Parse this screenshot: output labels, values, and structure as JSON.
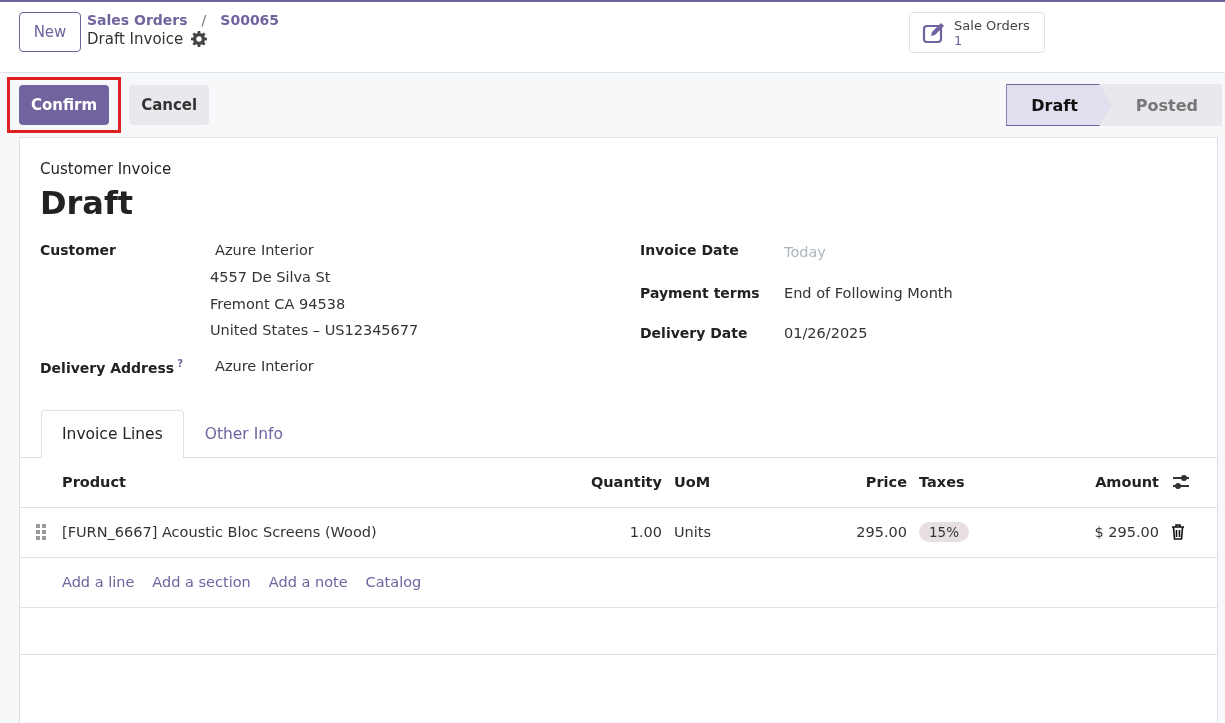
{
  "control_panel": {
    "new_button": "New",
    "breadcrumb_separator": "/",
    "breadcrumb": [
      {
        "label": "Sales Orders"
      },
      {
        "label": "S00065"
      }
    ],
    "record_title": "Draft Invoice",
    "smart_button": {
      "label": "Sale Orders",
      "count": "1"
    }
  },
  "actions": [
    {
      "label": "Confirm",
      "kind": "primary",
      "highlighted": true
    },
    {
      "label": "Cancel",
      "kind": "secondary",
      "highlighted": false
    }
  ],
  "statusbar": [
    {
      "label": "Draft",
      "selected": true
    },
    {
      "label": "Posted",
      "selected": false
    }
  ],
  "sheet": {
    "subtitle": "Customer Invoice",
    "title": "Draft",
    "left_fields": [
      {
        "label": "Customer",
        "value": "Azure Interior",
        "address": [
          "4557 De Silva St",
          "Fremont CA 94538",
          "United States – US12345677"
        ]
      },
      {
        "label": "Delivery Address",
        "help": "?",
        "value": "Azure Interior"
      }
    ],
    "right_fields": [
      {
        "label": "Invoice Date",
        "placeholder": "Today"
      },
      {
        "label": "Payment terms",
        "value": "End of Following Month"
      },
      {
        "label": "Delivery Date",
        "value": "01/26/2025"
      }
    ],
    "tabs": [
      {
        "label": "Invoice Lines",
        "selected": true
      },
      {
        "label": "Other Info",
        "selected": false
      }
    ],
    "table": {
      "columns": [
        "Product",
        "Quantity",
        "UoM",
        "Price",
        "Taxes",
        "Amount"
      ],
      "rows": [
        {
          "product": "[FURN_6667] Acoustic Bloc Screens (Wood)",
          "quantity": "1.00",
          "uom": "Units",
          "price": "295.00",
          "taxes": "15%",
          "amount": "$ 295.00"
        }
      ],
      "add_links": [
        "Add a line",
        "Add a section",
        "Add a note",
        "Catalog"
      ]
    }
  }
}
